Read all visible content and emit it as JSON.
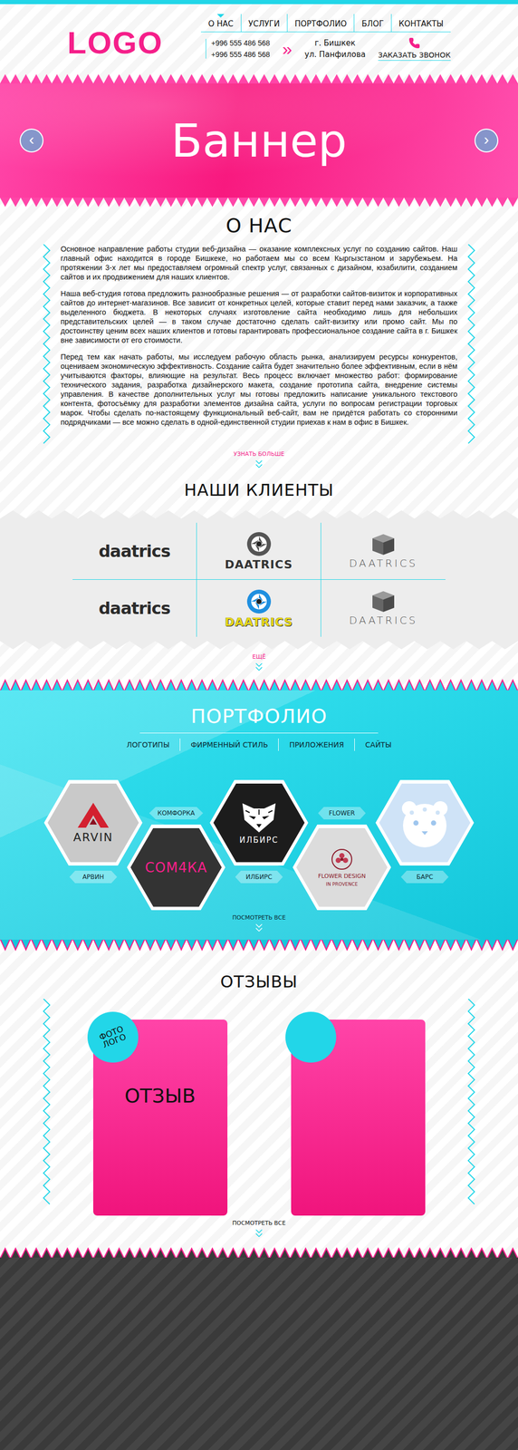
{
  "header": {
    "logo": "LOGO",
    "nav": [
      {
        "label": "О НАС",
        "selected": true
      },
      {
        "label": "УСЛУГИ",
        "selected": false
      },
      {
        "label": "ПОРТФОЛИО",
        "selected": false
      },
      {
        "label": "БЛОГ",
        "selected": false
      },
      {
        "label": "КОНТАКТЫ",
        "selected": false
      }
    ],
    "phones": [
      "+996 555 486 568",
      "+996 555 486 568"
    ],
    "arrow": "»",
    "address": [
      "г. Бишкек",
      "ул. Панфилова"
    ],
    "call": "ЗАКАЗАТЬ ЗВОНОК"
  },
  "banner": {
    "title": "Баннер",
    "prev": "‹",
    "next": "›"
  },
  "about": {
    "title": "О НАС",
    "paragraphs": [
      "Основное направление работы студии веб-дизайна — оказание комплексных услуг по созданию сайтов. Наш главный офис находится в городе Бишкеке, но работаем мы со всем Кыргызстаном и зарубежьем. На протяжении 3-х лет мы предоставляем огромный спектр услуг, связанных с дизайном, юзабилити, созданием сайтов и их продвижением для наших клиентов.",
      "Наша веб-студия готова предложить разнообразные решения — от разработки сайтов-визиток и корпоративных сайтов до интернет-магазинов. Все зависит от конкретных целей, которые ставит перед нами заказчик, а также выделенного бюджета. В некоторых случаях изготовление сайта необходимо лишь для небольших представительских целей — в таком случае достаточно сделать сайт-визитку или промо сайт. Мы по достоинству ценим всех наших клиентов и готовы гарантировать профессиональное создание сайта в г. Бишкек вне зависимости от его стоимости.",
      "Перед тем как начать работы, мы исследуем рабочую область рынка, анализируем ресурсы конкурентов, оцениваем экономическую эффективность. Создание сайта будет значительно более эффективным, если в нём учитываются факторы, влияющие на результат. Весь процесс включает множество работ: формирование технического задания, разработка дизайнерского макета, создание прототипа сайта, внедрение системы управления. В качестве дополнительных услуг мы готовы предложить написание уникального текстового контента, фотосъёмку для разработки элементов дизайна сайта, услуги по вопросам регистрации торговых марок. Чтобы сделать по-настоящему функциональный веб-сайт, вам не придётся работать со сторонними подрядчиками — все можно сделать в одной-единственной студии приехав к нам в офис в Бишкек."
    ],
    "more": "УЗНАТЬ БОЛЬШЕ"
  },
  "clients": {
    "title": "НАШИ КЛИЕНТЫ",
    "logos": [
      {
        "kind": "script",
        "text": "daatrics",
        "color": "#2b2b2b",
        "text_color": "#2b2b2b"
      },
      {
        "kind": "aperture",
        "text": "DAATRICS",
        "color": "#555555",
        "text_color": "#333333"
      },
      {
        "kind": "cube",
        "text": "DAATRICS",
        "color": "#666666",
        "text_color": "#555555"
      },
      {
        "kind": "script",
        "text": "daatrics",
        "color": "#2b2b2b",
        "text_color": "#2b2b2b"
      },
      {
        "kind": "aperture",
        "text": "DAATRICS",
        "color": "#1e8fe0",
        "text_color": "#e8d81a"
      },
      {
        "kind": "cube",
        "text": "DAATRICS",
        "color": "#666666",
        "text_color": "#555555"
      }
    ],
    "more": "ЕЩЁ"
  },
  "portfolio": {
    "title": "ПОРТФОЛИО",
    "tabs": [
      {
        "label": "ЛОГОТИПЫ",
        "selected": false
      },
      {
        "label": "ФИРМЕННЫЙ СТИЛЬ",
        "selected": false
      },
      {
        "label": "ПРИЛОЖЕНИЯ",
        "selected": false
      },
      {
        "label": "САЙТЫ",
        "selected": false
      }
    ],
    "items": [
      {
        "label": "АРВИН",
        "kind": "arvin",
        "logo": [
          "ARVIN"
        ],
        "color": "#c9c9c9"
      },
      {
        "label": "КОМФОРКА",
        "kind": "comforka",
        "logo": [
          "СОМ4КА"
        ],
        "color": "#333333"
      },
      {
        "label": "ИЛБИРС",
        "kind": "ilbirs",
        "logo": [
          "ИЛБИРС"
        ],
        "color": "#1c1c1c"
      },
      {
        "label": "FLOWER",
        "kind": "flower",
        "logo": [
          "FLOWER DESIGN",
          "IN PROVENCE"
        ],
        "color": "#dcdcdc"
      },
      {
        "label": "БАРС",
        "kind": "bars",
        "logo": [],
        "color": "#cfe3f7"
      }
    ],
    "more": "ПОСМОТРЕТЬ ВСЕ"
  },
  "reviews": {
    "title": "ОТЗЫВЫ",
    "cards": [
      {
        "photo": "ФОТО ЛОГО",
        "text": "ОТЗЫВ"
      },
      {
        "photo": "",
        "text": ""
      }
    ],
    "more": "ПОСМОТРЕТЬ ВСЕ"
  }
}
